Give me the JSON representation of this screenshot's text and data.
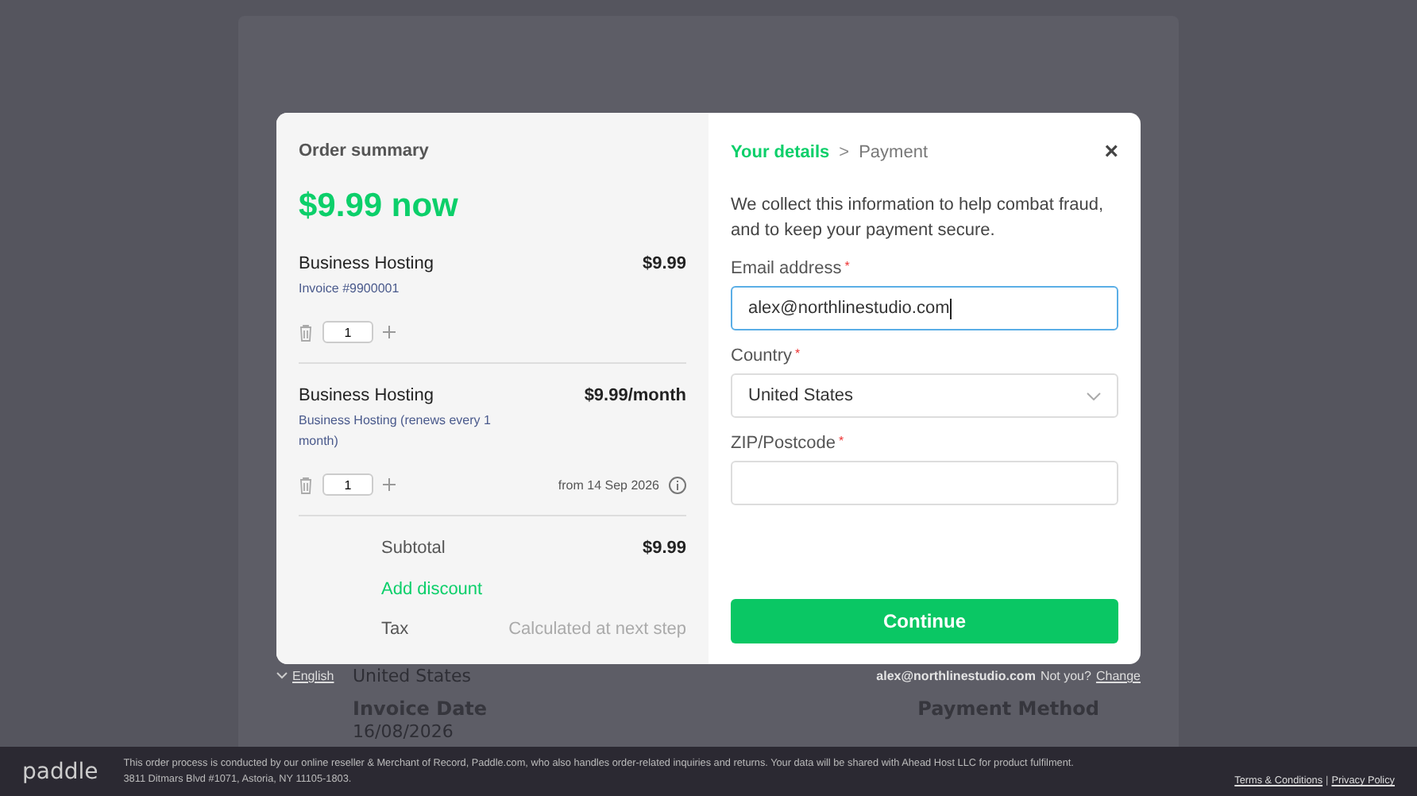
{
  "background_page": {
    "country": "United States",
    "invoice_date_label": "Invoice Date",
    "invoice_date": "16/08/2026",
    "payment_method_label": "Payment Method"
  },
  "order_summary": {
    "title": "Order summary",
    "total": "$9.99 now",
    "items": [
      {
        "name": "Business Hosting",
        "detail": "Invoice #9900001",
        "price": "$9.99",
        "quantity": "1"
      },
      {
        "name": "Business Hosting",
        "detail": "Business Hosting (renews every 1 month)",
        "price": "$9.99/month",
        "quantity": "1",
        "note": "from 14 Sep 2026"
      }
    ],
    "subtotal_label": "Subtotal",
    "subtotal": "$9.99",
    "discount_link": "Add discount",
    "tax_label": "Tax",
    "tax_value": "Calculated at next step"
  },
  "checkout": {
    "steps": [
      {
        "label": "Your details",
        "selected": true
      },
      {
        "label": "Payment",
        "selected": false
      }
    ],
    "step_separator": ">",
    "close": "×",
    "intro": "We collect this information to help combat fraud, and to keep your payment secure.",
    "required_mark": "*",
    "fields": [
      {
        "kind": "text",
        "label": "Email address",
        "required": true,
        "focused": true,
        "value": "alex@northlinestudio.com"
      },
      {
        "kind": "select",
        "label": "Country",
        "required": true,
        "focused": false,
        "value": "United States"
      },
      {
        "kind": "text",
        "label": "ZIP/Postcode",
        "required": true,
        "focused": false
      }
    ],
    "button": "Continue"
  },
  "language": "English",
  "account": {
    "email": "alex@northlinestudio.com",
    "prompt": "Not you?",
    "link": "Change"
  },
  "footer": {
    "brand": "paddle",
    "notice": "This order process is conducted by our online reseller & Merchant of Record, Paddle.com, who also handles order-related inquiries and returns.  Your data will be shared with Ahead Host LLC for product fulfilment.",
    "address": "3811 Ditmars Blvd #1071, Astoria, NY 11105-1803.",
    "links": [
      "Terms & Conditions",
      "Privacy Policy"
    ],
    "link_separator": "|"
  }
}
